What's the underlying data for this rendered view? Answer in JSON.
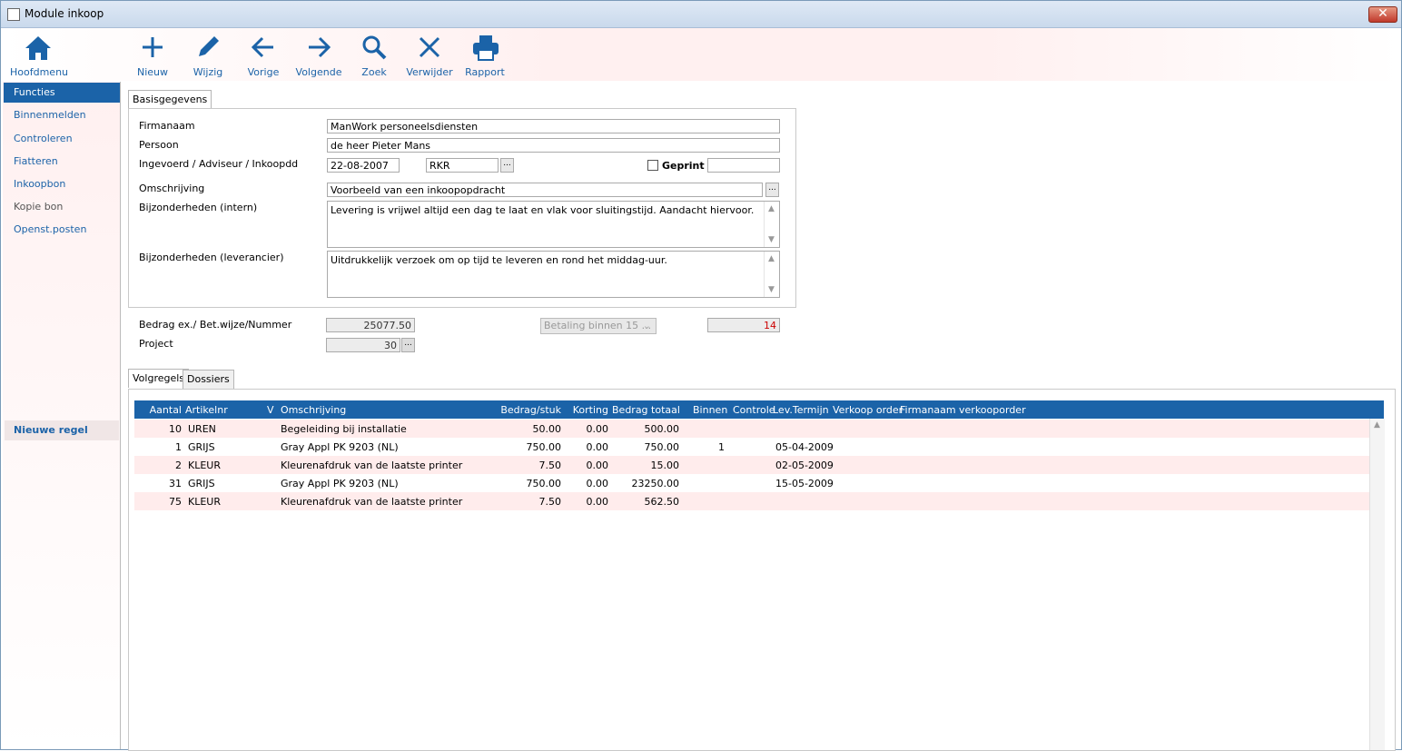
{
  "window": {
    "title": "Module inkoop",
    "close_symbol": "✕"
  },
  "toolbar": {
    "home_label": "Hoofdmenu",
    "buttons": [
      {
        "label": "Nieuw",
        "icon": "plus-icon"
      },
      {
        "label": "Wijzig",
        "icon": "pencil-icon"
      },
      {
        "label": "Vorige",
        "icon": "arrow-left-icon"
      },
      {
        "label": "Volgende",
        "icon": "arrow-right-icon"
      },
      {
        "label": "Zoek",
        "icon": "search-icon"
      },
      {
        "label": "Verwijder",
        "icon": "close-icon"
      },
      {
        "label": "Rapport",
        "icon": "printer-icon"
      }
    ]
  },
  "sidebar": {
    "active": "Functies",
    "items": [
      "Binnenmelden",
      "Controleren",
      "Fiatteren",
      "Inkoopbon",
      "Kopie bon",
      "Openst.posten"
    ],
    "new_row": "Nieuwe regel"
  },
  "tabs": {
    "basis": "Basisgegevens",
    "volgregels": "Volgregels",
    "dossiers": "Dossiers"
  },
  "form": {
    "firmanaam_label": "Firmanaam",
    "firmanaam": "ManWork personeelsdiensten",
    "persoon_label": "Persoon",
    "persoon": "de heer Pieter Mans",
    "ingevoerd_label": "Ingevoerd / Adviseur / Inkoopdd",
    "ingevoerd": "22-08-2007",
    "adviseur": "RKR",
    "dots": "...",
    "geprint_label": "Geprint",
    "geprint_value": "",
    "omschrijving_label": "Omschrijving",
    "omschrijving": "Voorbeeld van een inkoopopdracht",
    "bijz_intern_label": "Bijzonderheden (intern)",
    "bijz_intern": "Levering is vrijwel altijd een dag te laat en vlak voor sluitingstijd. Aandacht hiervoor.",
    "bijz_lev_label": "Bijzonderheden (leverancier)",
    "bijz_lev": "Uitdrukkelijk verzoek om op tijd te leveren en rond het middag-uur.",
    "bedrag_label": "Bedrag ex./ Bet.wijze/Nummer",
    "bedrag": "25077.50",
    "betaling": "Betaling binnen 15 ...",
    "nummer": "14",
    "project_label": "Project",
    "project": "30"
  },
  "grid": {
    "headers": {
      "aantal": "Aantal",
      "artikelnr": "Artikelnr",
      "v": "V",
      "omschrijving": "Omschrijving",
      "bedrag_stuk": "Bedrag/stuk",
      "korting": "Korting",
      "bedrag_totaal": "Bedrag totaal",
      "binnen": "Binnen",
      "controle": "Controle",
      "lev_termijn": "Lev.Termijn",
      "verkoop_order": "Verkoop order",
      "firmanaam_vk": "Firmanaam verkooporder"
    },
    "rows": [
      {
        "aantal": "10",
        "artikelnr": "UREN",
        "omschrijving": "Begeleiding bij installatie",
        "bedrag_stuk": "50.00",
        "korting": "0.00",
        "bedrag_totaal": "500.00",
        "binnen": "",
        "lev_termijn": ""
      },
      {
        "aantal": "1",
        "artikelnr": "GRIJS",
        "omschrijving": "Gray Appl PK 9203 (NL)",
        "bedrag_stuk": "750.00",
        "korting": "0.00",
        "bedrag_totaal": "750.00",
        "binnen": "1",
        "lev_termijn": "05-04-2009"
      },
      {
        "aantal": "2",
        "artikelnr": "KLEUR",
        "omschrijving": "Kleurenafdruk van de laatste printer",
        "bedrag_stuk": "7.50",
        "korting": "0.00",
        "bedrag_totaal": "15.00",
        "binnen": "",
        "lev_termijn": "02-05-2009"
      },
      {
        "aantal": "31",
        "artikelnr": "GRIJS",
        "omschrijving": "Gray Appl PK 9203 (NL)",
        "bedrag_stuk": "750.00",
        "korting": "0.00",
        "bedrag_totaal": "23250.00",
        "binnen": "",
        "lev_termijn": "15-05-2009"
      },
      {
        "aantal": "75",
        "artikelnr": "KLEUR",
        "omschrijving": "Kleurenafdruk van de laatste printer",
        "bedrag_stuk": "7.50",
        "korting": "0.00",
        "bedrag_totaal": "562.50",
        "binnen": "",
        "lev_termijn": ""
      }
    ]
  },
  "colors": {
    "accent": "#1b63a8",
    "row_alt": "#ffecec",
    "nummer_text": "#cc0000"
  }
}
